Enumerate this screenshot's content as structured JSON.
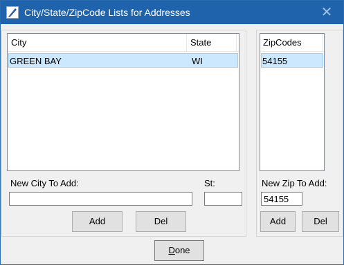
{
  "window": {
    "title": "City/State/ZipCode Lists for Addresses",
    "close_glyph": "✕",
    "accent": "#1f63ad"
  },
  "city_list": {
    "headers": {
      "city": "City",
      "state": "State"
    },
    "rows": [
      {
        "city": "GREEN BAY",
        "state": "WI"
      }
    ]
  },
  "city_form": {
    "new_city_label": "New City To Add:",
    "new_city_value": "",
    "state_label": "St:",
    "state_value": "",
    "add_label": "Add",
    "del_label": "Del"
  },
  "zip_list": {
    "header": "ZipCodes",
    "rows": [
      "54155"
    ]
  },
  "zip_form": {
    "new_zip_label": "New Zip To Add:",
    "new_zip_value": "54155",
    "add_label": "Add",
    "del_label": "Del"
  },
  "footer": {
    "done_mnemonic": "D",
    "done_rest": "one"
  },
  "icons": {
    "app": "feather-pen-icon",
    "close": "close-icon"
  }
}
